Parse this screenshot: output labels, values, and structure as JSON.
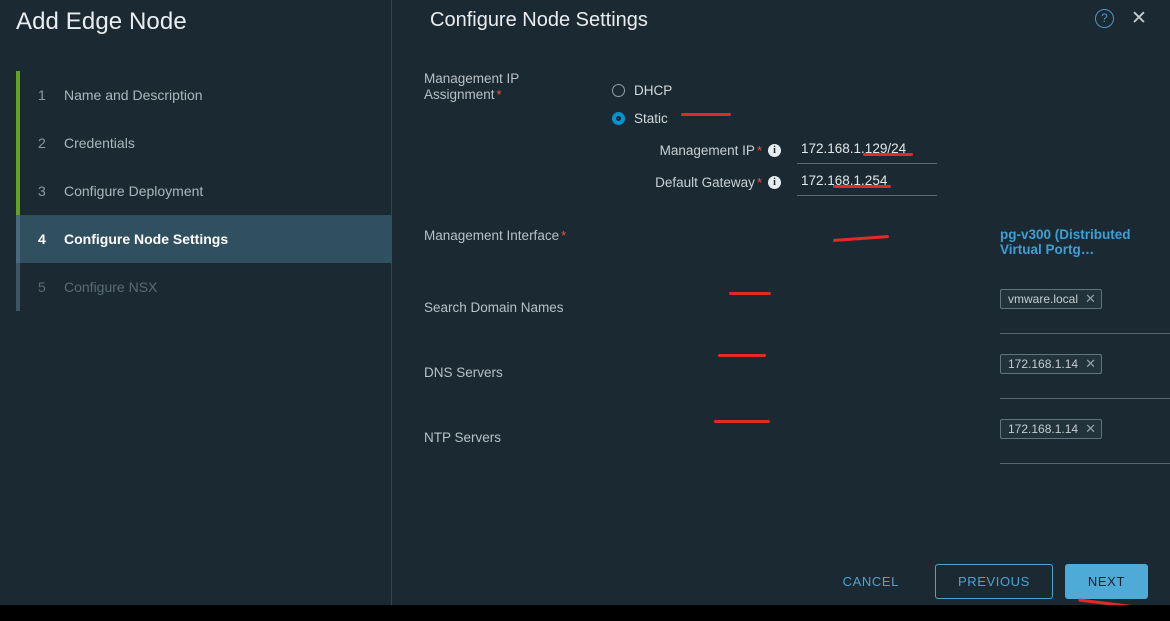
{
  "wizard": {
    "title": "Add Edge Node",
    "steps": [
      {
        "num": "1",
        "label": "Name and Description",
        "state": "done"
      },
      {
        "num": "2",
        "label": "Credentials",
        "state": "done"
      },
      {
        "num": "3",
        "label": "Configure Deployment",
        "state": "done"
      },
      {
        "num": "4",
        "label": "Configure Node Settings",
        "state": "active"
      },
      {
        "num": "5",
        "label": "Configure NSX",
        "state": "pending"
      }
    ]
  },
  "header": {
    "title": "Configure Node Settings",
    "help_icon": "help-circle-icon",
    "help_glyph": "?",
    "close_icon": "close-icon",
    "close_glyph": "✕"
  },
  "form": {
    "ip_assignment": {
      "label": "Management IP",
      "label_line2": "Assignment",
      "required": "*",
      "options": [
        {
          "label": "DHCP",
          "selected": false
        },
        {
          "label": "Static",
          "selected": true
        }
      ]
    },
    "management_ip": {
      "label": "Management IP",
      "required": "*",
      "info": "info-icon",
      "value": "172.168.1.129/24"
    },
    "default_gateway": {
      "label": "Default Gateway",
      "required": "*",
      "info": "info-icon",
      "value": "172.168.1.254"
    },
    "management_interface": {
      "label": "Management Interface",
      "required": "*",
      "value": "pg-v300 (Distributed Virtual Portg…"
    },
    "search_domain_names": {
      "label": "Search Domain Names",
      "chips": [
        "vmware.local"
      ],
      "remove_glyph": "✕"
    },
    "dns_servers": {
      "label": "DNS Servers",
      "chips": [
        "172.168.1.14"
      ],
      "remove_glyph": "✕"
    },
    "ntp_servers": {
      "label": "NTP Servers",
      "chips": [
        "172.168.1.14"
      ],
      "remove_glyph": "✕"
    }
  },
  "footer": {
    "cancel_label": "CANCEL",
    "previous_label": "PREVIOUS",
    "next_label": "NEXT"
  },
  "colors": {
    "accent": "#4eaad6",
    "link": "#3e9fd4",
    "progress_done": "#62a420",
    "annotation": "#e32b25",
    "background": "#1b2a32",
    "active_step": "#30505f",
    "required": "#f54f47"
  }
}
